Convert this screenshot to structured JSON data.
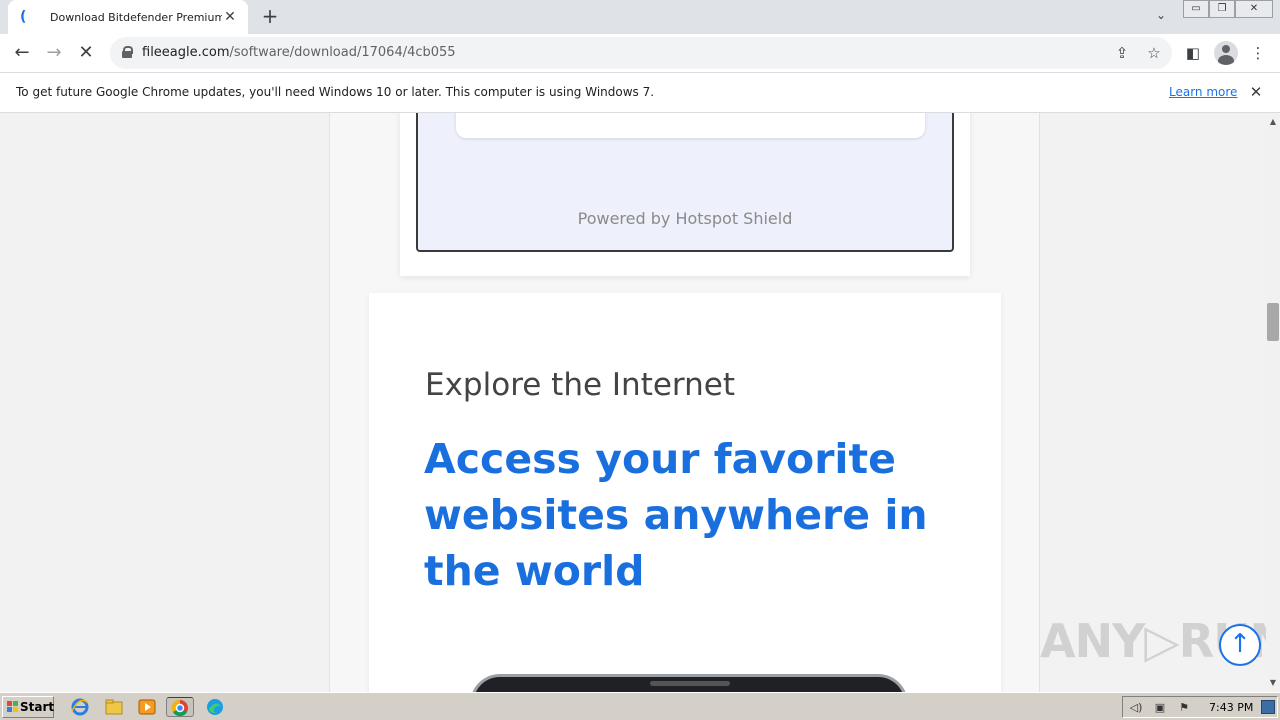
{
  "browser": {
    "tab_title": "Download Bitdefender Premium VPN",
    "tab_favicon": "(",
    "new_tab_symbol": "+",
    "tab_close_symbol": "✕",
    "tab_search_symbol": "⌄",
    "window_controls": {
      "minimize": "▭",
      "restore": "❐",
      "close": "✕"
    },
    "nav": {
      "back": "←",
      "forward": "→",
      "reload_stop": "✕"
    },
    "url_host": "fileeagle.com",
    "url_path": "/software/download/17064/4cb055",
    "share_symbol": "⇪",
    "bookmark_symbol": "☆",
    "side_panel_symbol": "◧",
    "menu_symbol": "⋮"
  },
  "infobar": {
    "message": "To get future Google Chrome updates, you'll need Windows 10 or later. This computer is using Windows 7.",
    "learn_more": "Learn more",
    "close_symbol": "✕"
  },
  "page": {
    "powered_by": "Powered by Hotspot Shield",
    "kicker": "Explore the Internet",
    "headline": "Access your favorite websites anywhere in the world",
    "scroll_top_symbol": "↑"
  },
  "watermark": "ANY▷RUN",
  "scrollbar": {
    "up": "▲",
    "down": "▼"
  },
  "taskbar": {
    "start_label": "Start",
    "clock": "7:43 PM",
    "tray_icons": [
      "◁)",
      "▣",
      "⚑"
    ],
    "start_flag_colors": [
      "#e8472b",
      "#4caf50",
      "#2f7fe0",
      "#f5c400"
    ]
  }
}
